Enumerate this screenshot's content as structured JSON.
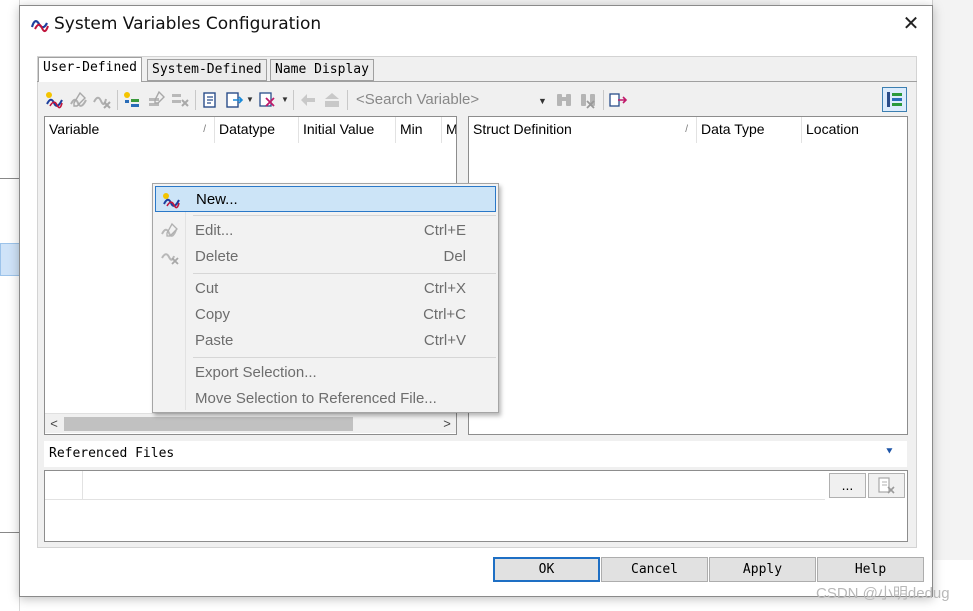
{
  "dialog": {
    "title": "System Variables Configuration",
    "close_label": "✕"
  },
  "tabs": [
    {
      "label": "User-Defined",
      "active": true
    },
    {
      "label": "System-Defined",
      "active": false
    },
    {
      "label": "Name Display",
      "active": false
    }
  ],
  "toolbar": {
    "search_placeholder": "<Search Variable>",
    "icons": [
      "new-variable-icon",
      "edit-variable-icon",
      "delete-variable-icon",
      "new-struct-icon",
      "edit-struct-icon",
      "delete-struct-icon",
      "import-icon",
      "export-icon",
      "filter-icon",
      "move-up-icon",
      "move-down-icon",
      "find-icon",
      "find-clear-icon",
      "goto-icon",
      "layout-toggle-icon"
    ]
  },
  "variables_table": {
    "columns": [
      "Variable",
      "Datatype",
      "Initial Value",
      "Min",
      "M"
    ]
  },
  "struct_table": {
    "columns": [
      "Struct Definition",
      "Data Type",
      "Location"
    ]
  },
  "context_menu": {
    "items": [
      {
        "label": "New...",
        "shortcut": "",
        "enabled": true,
        "highlighted": true
      },
      {
        "label": "Edit...",
        "shortcut": "Ctrl+E",
        "enabled": false
      },
      {
        "label": "Delete",
        "shortcut": "Del",
        "enabled": false
      },
      {
        "label": "Cut",
        "shortcut": "Ctrl+X",
        "enabled": false
      },
      {
        "label": "Copy",
        "shortcut": "Ctrl+C",
        "enabled": false
      },
      {
        "label": "Paste",
        "shortcut": "Ctrl+V",
        "enabled": false
      },
      {
        "label": "Export Selection...",
        "shortcut": "",
        "enabled": false
      },
      {
        "label": "Move Selection to Referenced File...",
        "shortcut": "",
        "enabled": false
      }
    ]
  },
  "referenced_files": {
    "label": "Referenced Files",
    "browse_label": "..."
  },
  "buttons": {
    "ok": "OK",
    "cancel": "Cancel",
    "apply": "Apply",
    "help": "Help"
  },
  "watermark": "CSDN @小明dedug",
  "colors": {
    "accent": "#1e6fc4",
    "menu_highlight": "#cce4f7",
    "disabled_text": "#6d6d6d"
  }
}
